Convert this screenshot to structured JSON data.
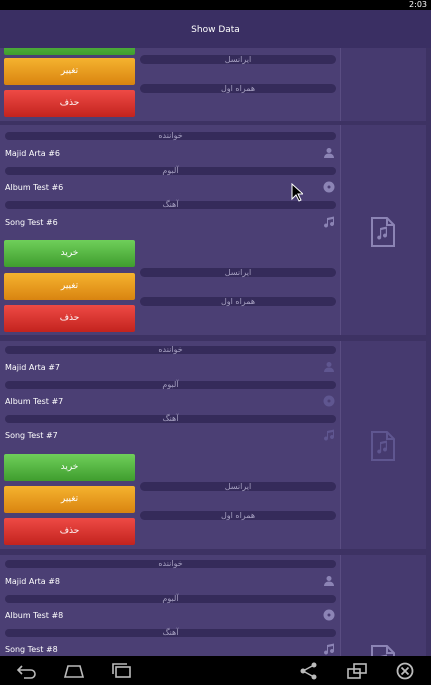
{
  "status": {
    "time": "2:03"
  },
  "appbar": {
    "title": "Show Data"
  },
  "labels": {
    "singer": "خواننده",
    "album": "آلبوم",
    "song": "آهنگ",
    "irancell": "ایرانسل",
    "hamrah": "همراه اول",
    "buy": "خرید",
    "edit": "تغییر",
    "delete": "حذف"
  },
  "items": [
    {
      "singer": "Majid Arta #6",
      "album": "Album Test #6",
      "song": "Song Test #6"
    },
    {
      "singer": "Majid Arta #7",
      "album": "Album Test #7",
      "song": "Song Test #7"
    },
    {
      "singer": "Majid Arta #8",
      "album": "Album Test #8",
      "song": "Song Test #8"
    }
  ],
  "icons": {
    "person": "person-icon",
    "album": "disc-icon",
    "song": "music-note-icon",
    "doc": "music-file-icon"
  },
  "colors": {
    "appbar": "#3a2f63",
    "card": "#4b3f74",
    "buy": "#4fae3b",
    "edit": "#e9a020",
    "delete": "#d8322d"
  }
}
